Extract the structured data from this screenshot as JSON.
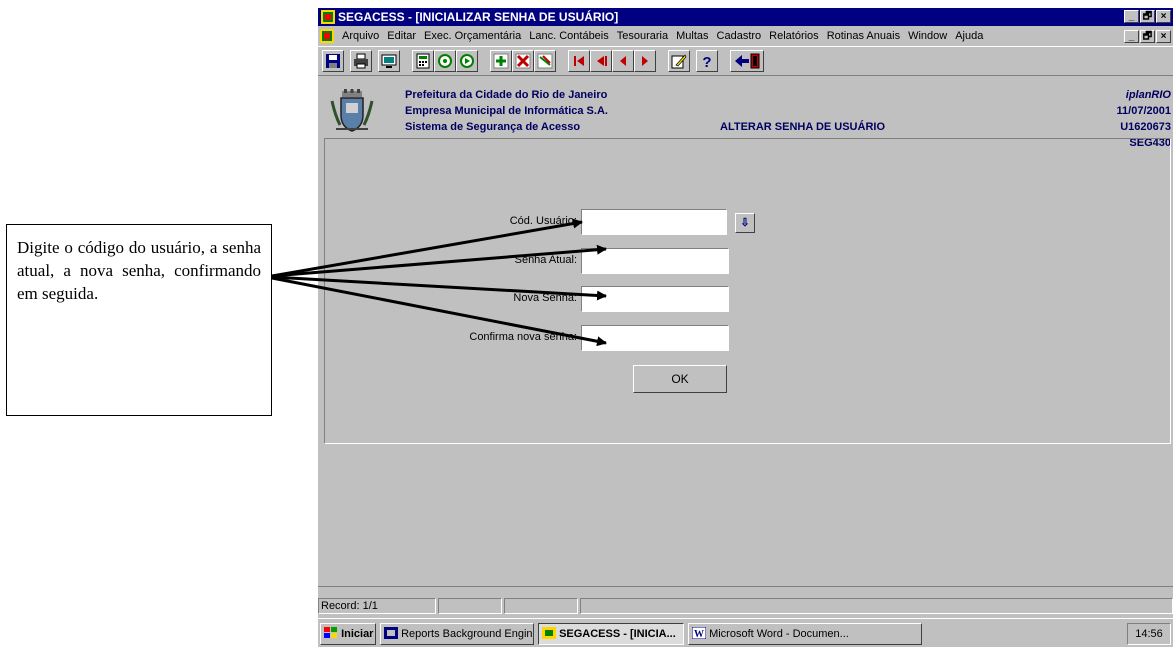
{
  "window": {
    "title": "SEGACESS - [INICIALIZAR SENHA DE USUÁRIO]",
    "min_label": "_",
    "max_label": "🗗",
    "close_label": "×"
  },
  "menu": {
    "items": [
      "Arquivo",
      "Editar",
      "Exec. Orçamentária",
      "Lanc. Contábeis",
      "Tesouraria",
      "Multas",
      "Cadastro",
      "Relatórios",
      "Rotinas Anuais",
      "Window",
      "Ajuda"
    ]
  },
  "toolbar": {
    "icons": [
      "save-icon",
      "print-icon",
      "screen-icon",
      "calculator-icon",
      "query-icon",
      "execute-icon",
      "insert-record-icon",
      "delete-record-icon",
      "clear-icon",
      "first-record-icon",
      "previous-set-icon",
      "previous-record-icon",
      "next-record-icon",
      "edit-icon",
      "help-icon",
      "exit-icon"
    ]
  },
  "header": {
    "line1": "Prefeitura da Cidade do Rio de Janeiro",
    "line2": "Empresa Municipal de Informática S.A.",
    "line3": "Sistema de Segurança de Acesso",
    "screen_title": "ALTERAR SENHA DE USUÁRIO",
    "brand": "iplanRIO",
    "date": "11/07/2001",
    "user": "U1620673",
    "screen_code": "SEG430"
  },
  "form": {
    "cod_usuario_label": "Cód. Usuário:",
    "cod_usuario_value": "",
    "senha_atual_label": "Senha Atual:",
    "senha_atual_value": "",
    "nova_senha_label": "Nova Senha:",
    "nova_senha_value": "",
    "confirma_label": "Confirma nova senha:",
    "confirma_value": "",
    "lov_symbol": "⇩",
    "ok_label": "OK"
  },
  "status": {
    "record": "Record: 1/1"
  },
  "taskbar": {
    "start": "Iniciar",
    "task1": "Reports Background Engine",
    "task2": "SEGACESS - [INICIA...",
    "task3": "Microsoft Word - Documen...",
    "clock": "14:56"
  },
  "callout": {
    "text": "Digite o código do usuário, a senha atual, a nova senha, confirmando em seguida."
  },
  "colors": {
    "title_bar": "#000080",
    "face": "#c0c0c0",
    "header_text": "#000060"
  }
}
